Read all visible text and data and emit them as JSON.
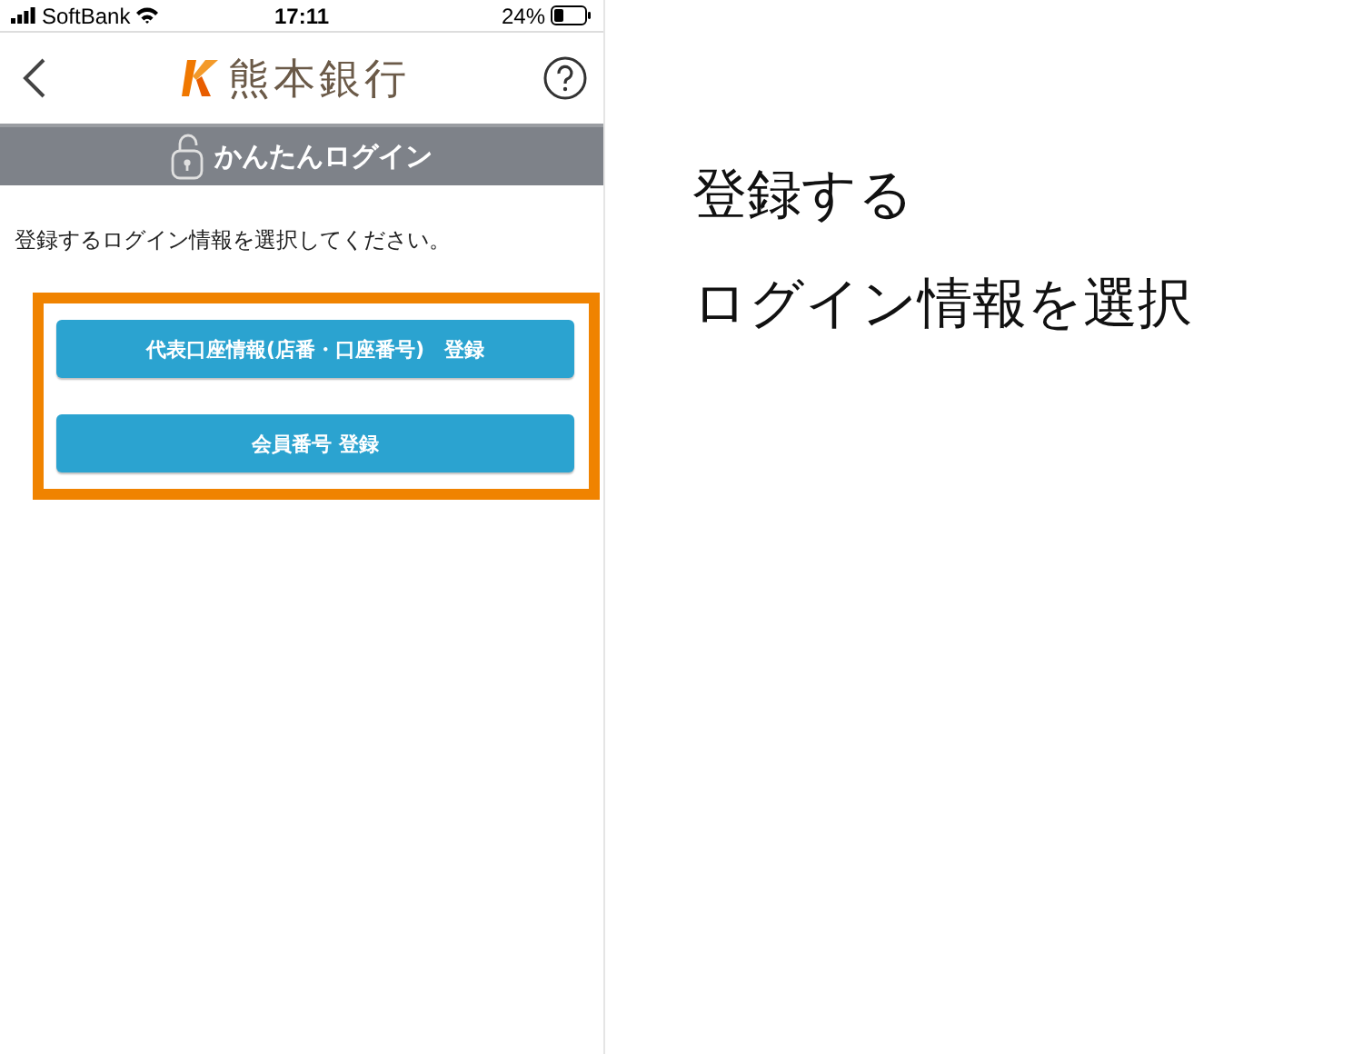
{
  "status_bar": {
    "carrier": "SoftBank",
    "time": "17:11",
    "battery": "24%"
  },
  "header": {
    "logo_text": "熊本銀行"
  },
  "banner": {
    "title": "かんたんログイン"
  },
  "instruction": "登録するログイン情報を選択してください。",
  "buttons": [
    {
      "label": "代表口座情報(店番・口座番号)　登録"
    },
    {
      "label": "会員番号 登録"
    }
  ],
  "caption": [
    "登録する",
    "ログイン情報を選択"
  ]
}
